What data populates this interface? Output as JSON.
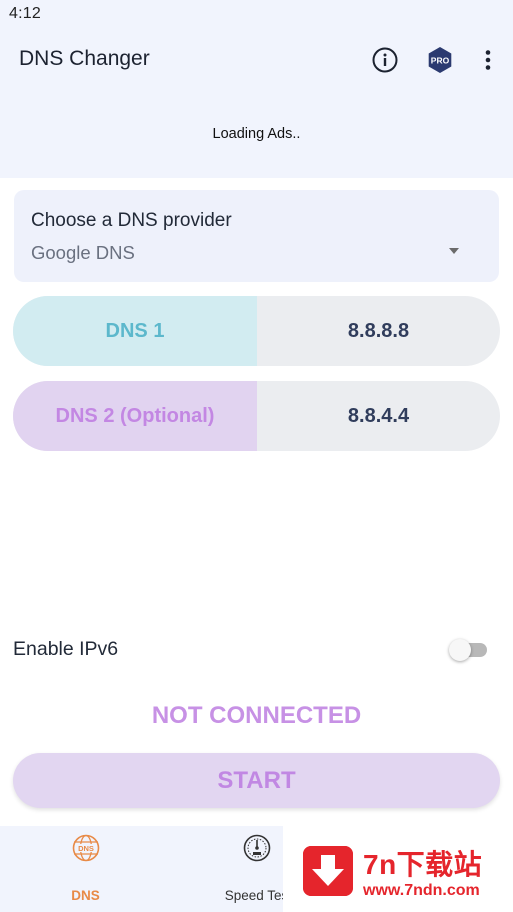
{
  "status_bar": {
    "time": "4:12"
  },
  "app_bar": {
    "title": "DNS Changer",
    "icons": [
      "info-icon",
      "pro-badge-icon",
      "more-vert-icon"
    ],
    "pro_badge_text": "PRO"
  },
  "ad_banner": {
    "text": "Loading Ads.."
  },
  "provider": {
    "label": "Choose a DNS provider",
    "selected": "Google DNS"
  },
  "dns": [
    {
      "label": "DNS 1",
      "value": "8.8.8.8"
    },
    {
      "label": "DNS 2 (Optional)",
      "value": "8.8.4.4"
    }
  ],
  "ipv6": {
    "label": "Enable IPv6",
    "enabled": false
  },
  "connection": {
    "status": "NOT CONNECTED",
    "start_label": "START"
  },
  "bottom_nav": [
    {
      "label": "DNS",
      "icon": "dns-globe-icon",
      "active": true
    },
    {
      "label": "Speed Tes",
      "icon": "speedometer-icon",
      "active": false
    }
  ],
  "watermark": {
    "title": "7n下载站",
    "url": "www.7ndn.com"
  },
  "colors": {
    "header_bg": "#f1f4fd",
    "dns1_accent": "#5cb8cc",
    "dns2_accent": "#c387e3",
    "start_bg": "#e2d6f1",
    "nav_active": "#e88a47",
    "watermark_red": "#e5252c"
  }
}
